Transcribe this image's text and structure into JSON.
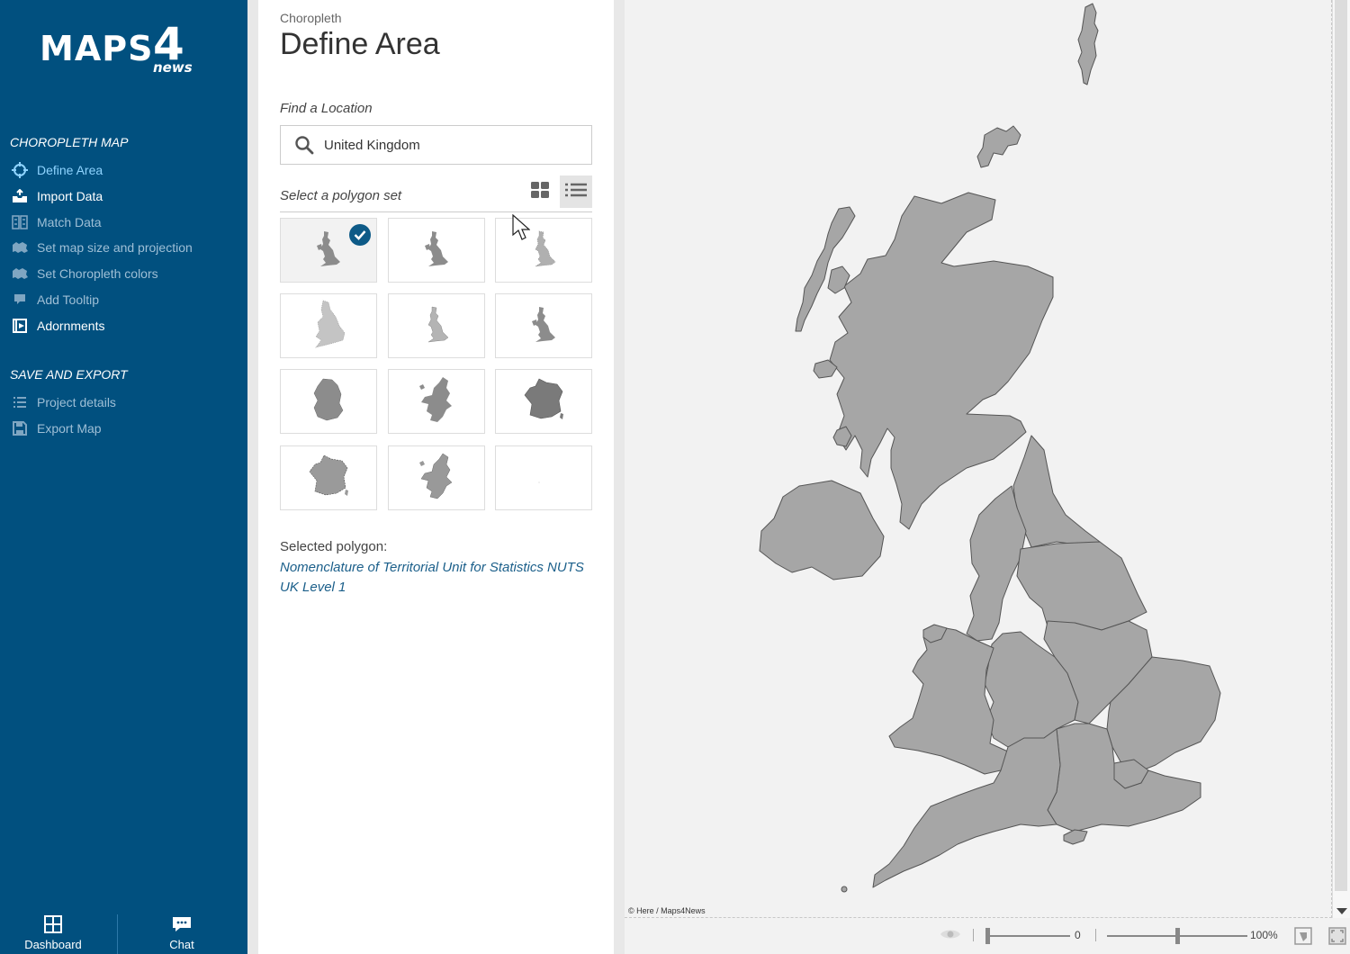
{
  "app": {
    "logo_text": "MAPS",
    "logo_number": "4",
    "logo_sub": "news",
    "brand_color": "#01507f",
    "accent_color": "#8fd4ff"
  },
  "sidebar": {
    "section1": "CHOROPLETH MAP",
    "items": [
      {
        "label": "Define Area",
        "icon": "crosshair-icon",
        "state": "active"
      },
      {
        "label": "Import Data",
        "icon": "inbox-upload-icon",
        "state": "enabled"
      },
      {
        "label": "Match Data",
        "icon": "match-icon",
        "state": "disabled"
      },
      {
        "label": "Set map size and projection",
        "icon": "map-shape-icon",
        "state": "disabled"
      },
      {
        "label": "Set Choropleth colors",
        "icon": "map-shape-icon",
        "state": "disabled"
      },
      {
        "label": "Add Tooltip",
        "icon": "tooltip-icon",
        "state": "disabled"
      },
      {
        "label": "Adornments",
        "icon": "adornment-icon",
        "state": "enabled"
      }
    ],
    "section2": "SAVE AND EXPORT",
    "items2": [
      {
        "label": "Project details",
        "icon": "list-icon",
        "state": "disabled"
      },
      {
        "label": "Export Map",
        "icon": "save-icon",
        "state": "disabled"
      }
    ],
    "bottom": {
      "dashboard": "Dashboard",
      "chat": "Chat"
    }
  },
  "panel": {
    "breadcrumb": "Choropleth",
    "title": "Define Area",
    "find_label": "Find a Location",
    "search_value": "United Kingdom",
    "polygon_label": "Select a polygon set",
    "selected_label": "Selected polygon:",
    "selected_value": "Nomenclature of Territorial Unit for Statistics NUTS UK Level 1",
    "tiles": [
      {
        "icon": "uk-map-icon",
        "selected": true
      },
      {
        "icon": "uk-map-icon",
        "selected": false
      },
      {
        "icon": "uk-map-icon",
        "selected": false
      },
      {
        "icon": "england-map-icon",
        "selected": false
      },
      {
        "icon": "uk-map-icon",
        "selected": false
      },
      {
        "icon": "uk-map-icon",
        "selected": false
      },
      {
        "icon": "ireland-map-icon",
        "selected": false
      },
      {
        "icon": "europe-map-icon",
        "selected": false
      },
      {
        "icon": "france-map-icon",
        "selected": false
      },
      {
        "icon": "france-map-icon",
        "selected": false
      },
      {
        "icon": "europe-map-icon",
        "selected": false
      },
      {
        "icon": "blank-map-icon",
        "selected": false
      }
    ]
  },
  "map": {
    "attribution": "© Here / Maps4News",
    "slider1_value": "0",
    "zoom_value": "100%",
    "region_fill": "#a6a6a6",
    "region_stroke": "#555555"
  }
}
